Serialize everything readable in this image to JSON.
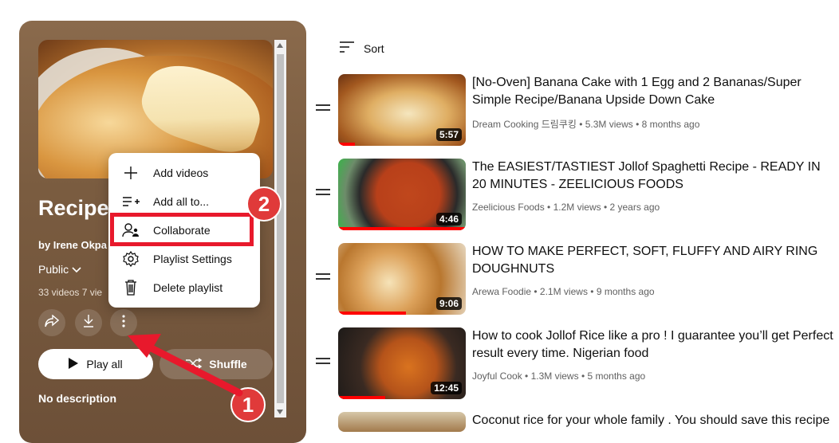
{
  "playlist": {
    "title": "Recipes",
    "owner": "by Irene Okpa",
    "privacy": "Public",
    "stats": "33 videos  7 vie",
    "play_all_label": "Play all",
    "shuffle_label": "Shuffle",
    "description": "No description"
  },
  "menu": {
    "items": [
      {
        "label": "Add videos",
        "icon": "plus-icon"
      },
      {
        "label": "Add all to...",
        "icon": "add-all-icon"
      },
      {
        "label": "Collaborate",
        "icon": "collaborate-icon"
      },
      {
        "label": "Playlist Settings",
        "icon": "gear-icon"
      },
      {
        "label": "Delete playlist",
        "icon": "trash-icon"
      }
    ]
  },
  "annotations": {
    "step1": "1",
    "step2": "2",
    "highlight_color": "#e8192c"
  },
  "sort_label": "Sort",
  "videos": [
    {
      "title": "[No-Oven] Banana Cake with 1 Egg and 2 Bananas/Super Simple Recipe/Banana Upside Down Cake",
      "channel": "Dream Cooking 드림쿠킹",
      "views": "5.3M views",
      "age": "8 months ago",
      "duration": "5:57",
      "progress": 0.13
    },
    {
      "title": "The EASIEST/TASTIEST Jollof Spaghetti Recipe - READY IN 20 MINUTES - ZEELICIOUS FOODS",
      "channel": "Zeelicious Foods",
      "views": "1.2M views",
      "age": "2 years ago",
      "duration": "4:46",
      "progress": 1.0
    },
    {
      "title": "HOW TO MAKE PERFECT, SOFT, FLUFFY AND AIRY RING DOUGHNUTS",
      "channel": "Arewa Foodie",
      "views": "2.1M views",
      "age": "9 months ago",
      "duration": "9:06",
      "progress": 0.53
    },
    {
      "title": "How to cook Jollof Rice like a pro ! I guarantee you’ll get Perfect result every time. Nigerian food",
      "channel": "Joyful Cook",
      "views": "1.3M views",
      "age": "5 months ago",
      "duration": "12:45",
      "progress": 0.37
    },
    {
      "title": "Coconut rice for your whole family . You should save this recipe",
      "channel": "",
      "views": "",
      "age": "",
      "duration": "",
      "progress": 0
    }
  ]
}
